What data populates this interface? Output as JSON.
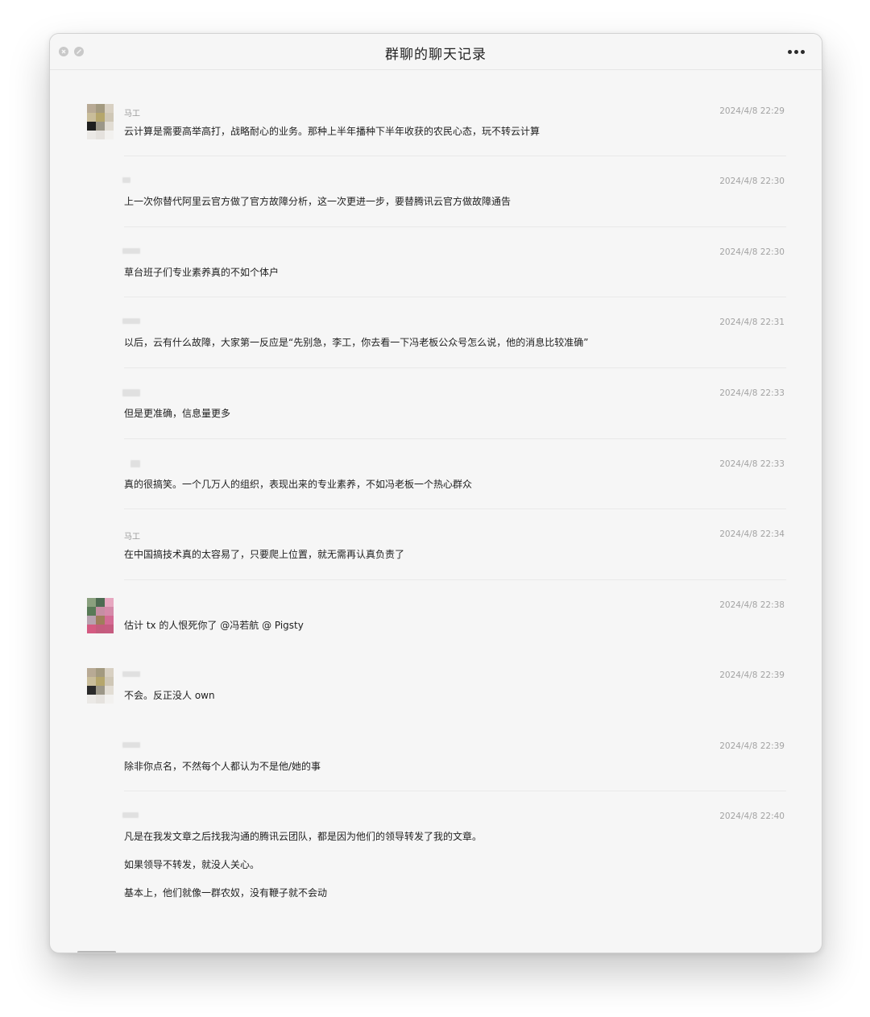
{
  "window": {
    "title": "群聊的聊天记录",
    "more_icon": "more-horizontal-icon"
  },
  "messages": [
    {
      "sender": "马工",
      "time": "2024/4/8 22:29",
      "lines": [
        "云计算是需要高举高打，战略耐心的业务。那种上半年播种下半年收获的农民心态，玩不转云计算"
      ]
    },
    {
      "sender": "",
      "time": "2024/4/8 22:30",
      "lines": [
        "上一次你替代阿里云官方做了官方故障分析，这一次更进一步，要替腾讯云官方做故障通告"
      ]
    },
    {
      "sender": "",
      "time": "2024/4/8 22:30",
      "lines": [
        "草台班子们专业素养真的不如个体户"
      ]
    },
    {
      "sender": "",
      "time": "2024/4/8 22:31",
      "lines": [
        "以后，云有什么故障，大家第一反应是“先别急，李工，你去看一下冯老板公众号怎么说，他的消息比较准确”"
      ]
    },
    {
      "sender": "",
      "time": "2024/4/8 22:33",
      "lines": [
        "但是更准确，信息量更多"
      ]
    },
    {
      "sender": "",
      "time": "2024/4/8 22:33",
      "lines": [
        "真的很搞笑。一个几万人的组织，表现出来的专业素养，不如冯老板一个热心群众"
      ]
    },
    {
      "sender": "马工",
      "time": "2024/4/8 22:34",
      "lines": [
        "在中国搞技术真的太容易了，只要爬上位置，就无需再认真负责了"
      ]
    },
    {
      "sender": "",
      "time": "2024/4/8 22:38",
      "lines": [
        "估计 tx 的人恨死你了 @冯若航 @ Pigsty"
      ]
    },
    {
      "sender": "",
      "time": "2024/4/8 22:39",
      "lines": [
        "不会。反正没人 own"
      ]
    },
    {
      "sender": "",
      "time": "2024/4/8 22:39",
      "lines": [
        "除非你点名，不然每个人都认为不是他/她的事"
      ]
    },
    {
      "sender": "",
      "time": "2024/4/8 22:40",
      "lines": [
        "凡是在我发文章之后找我沟通的腾讯云团队，都是因为他们的领导转发了我的文章。",
        "如果领导不转发，就没人关心。",
        "基本上，他们就像一群农奴，没有鞭子就不会动"
      ]
    }
  ],
  "colors": {
    "window_bg": "#f6f6f6",
    "text": "#1e1e1e",
    "meta": "#a3a3a3"
  }
}
